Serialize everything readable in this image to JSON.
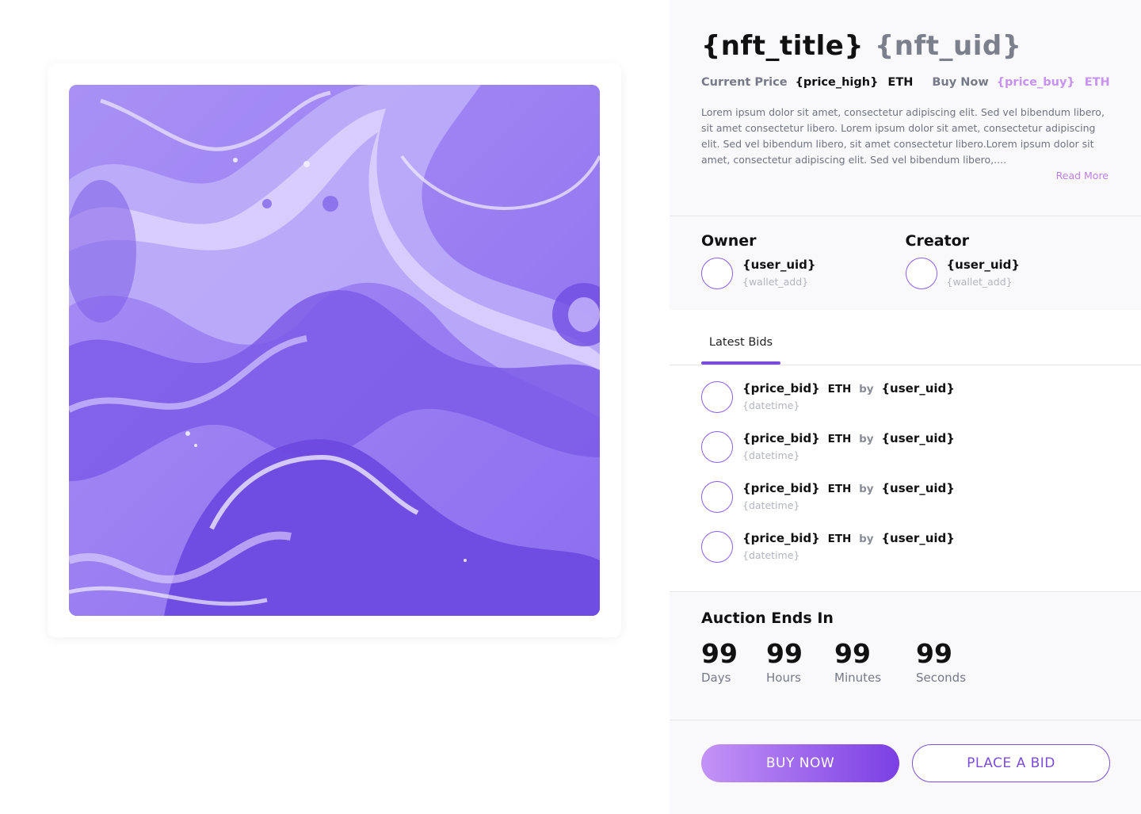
{
  "nft": {
    "title": "{nft_title}",
    "uid": "{nft_uid}",
    "current_price_label": "Current Price",
    "price_high": "{price_high}",
    "price_high_unit": "ETH",
    "buy_now_label": "Buy Now",
    "price_buy": "{price_buy}",
    "price_buy_unit": "ETH",
    "description": "Lorem ipsum dolor sit amet, consectetur adipiscing elit. Sed vel bibendum libero, sit amet consectetur libero.  Lorem ipsum dolor sit amet, consectetur adipiscing elit. Sed vel bibendum libero, sit amet consectetur libero.Lorem ipsum dolor sit amet, consectetur adipiscing elit. Sed vel bibendum libero,....",
    "read_more": "Read More"
  },
  "owner": {
    "heading": "Owner",
    "uid": "{user_uid}",
    "wallet": "{wallet_add}"
  },
  "creator": {
    "heading": "Creator",
    "uid": "{user_uid}",
    "wallet": "{wallet_add}"
  },
  "bids": {
    "tab_label": "Latest Bids",
    "items": [
      {
        "price": "{price_bid}",
        "unit": "ETH",
        "by": "by",
        "user": "{user_uid}",
        "time": "{datetime}"
      },
      {
        "price": "{price_bid}",
        "unit": "ETH",
        "by": "by",
        "user": "{user_uid}",
        "time": "{datetime}"
      },
      {
        "price": "{price_bid}",
        "unit": "ETH",
        "by": "by",
        "user": "{user_uid}",
        "time": "{datetime}"
      },
      {
        "price": "{price_bid}",
        "unit": "ETH",
        "by": "by",
        "user": "{user_uid}",
        "time": "{datetime}"
      }
    ]
  },
  "auction": {
    "title": "Auction Ends In",
    "days": {
      "value": "99",
      "label": "Days"
    },
    "hours": {
      "value": "99",
      "label": "Hours"
    },
    "minutes": {
      "value": "99",
      "label": "Minutes"
    },
    "seconds": {
      "value": "99",
      "label": "Seconds"
    }
  },
  "actions": {
    "buy_now": "BUY NOW",
    "place_bid": "PLACE A BID"
  },
  "colors": {
    "accent": "#7c4ddb",
    "accent_light": "#c493f6",
    "price_buy": "#c892f2",
    "artwork_base": "#8c6ff0"
  }
}
